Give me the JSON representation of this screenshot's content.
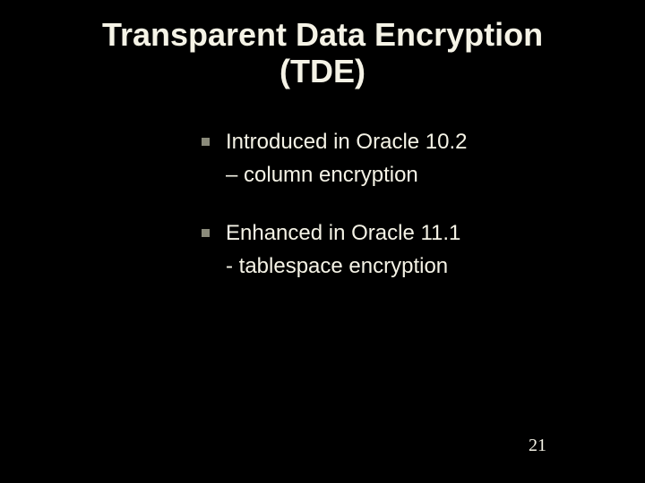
{
  "slide": {
    "title_line1": "Transparent Data Encryption",
    "title_line2": "(TDE)",
    "bullets": [
      {
        "main": "Introduced in Oracle 10.2",
        "sub": "– column encryption"
      },
      {
        "main": "Enhanced in Oracle 11.1",
        "sub": "- tablespace encryption"
      }
    ],
    "page_number": "21"
  }
}
